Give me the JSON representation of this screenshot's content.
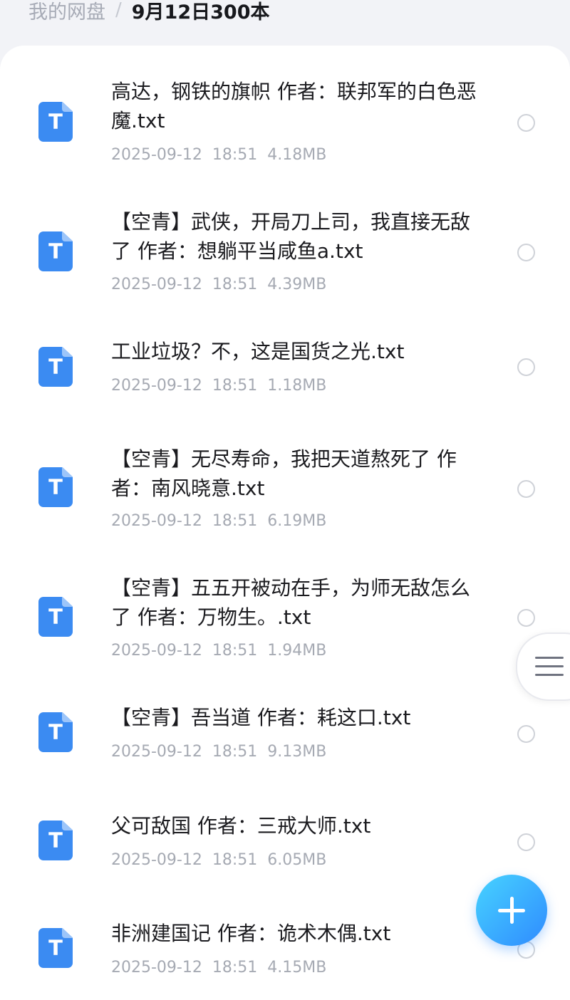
{
  "breadcrumb": {
    "root": "我的网盘",
    "separator": "/",
    "current": "9月12日300本"
  },
  "file_icon": {
    "letter": "T",
    "icon": "text-file-icon",
    "color": "#3b8bf2"
  },
  "files": [
    {
      "name": "高达，钢铁的旗帜 作者：联邦军的白色恶魔.txt",
      "date": "2025-09-12",
      "time": "18:51",
      "size": "4.18MB"
    },
    {
      "name": "【空青】武侠，开局刀上司，我直接无敌了 作者：想躺平当咸鱼a.txt",
      "date": "2025-09-12",
      "time": "18:51",
      "size": "4.39MB"
    },
    {
      "name": "工业垃圾？不，这是国货之光.txt",
      "date": "2025-09-12",
      "time": "18:51",
      "size": "1.18MB"
    },
    {
      "name": "【空青】无尽寿命，我把天道熬死了 作者：南风晓意.txt",
      "date": "2025-09-12",
      "time": "18:51",
      "size": "6.19MB"
    },
    {
      "name": "【空青】五五开被动在手，为师无敌怎么了 作者：万物生。.txt",
      "date": "2025-09-12",
      "time": "18:51",
      "size": "1.94MB"
    },
    {
      "name": "【空青】吾当道 作者：耗这口.txt",
      "date": "2025-09-12",
      "time": "18:51",
      "size": "9.13MB"
    },
    {
      "name": "父可敌国 作者：三戒大师.txt",
      "date": "2025-09-12",
      "time": "18:51",
      "size": "6.05MB"
    },
    {
      "name": "非洲建国记 作者：诡术木偶.txt",
      "date": "2025-09-12",
      "time": "18:51",
      "size": "4.15MB"
    }
  ],
  "fab": {
    "icon": "plus-icon"
  },
  "side_handle": {
    "icon": "menu-lines-icon"
  },
  "colors": {
    "accent": "#2f8bff",
    "meta_text": "#a6aab3",
    "background": "#f2f3f7"
  }
}
